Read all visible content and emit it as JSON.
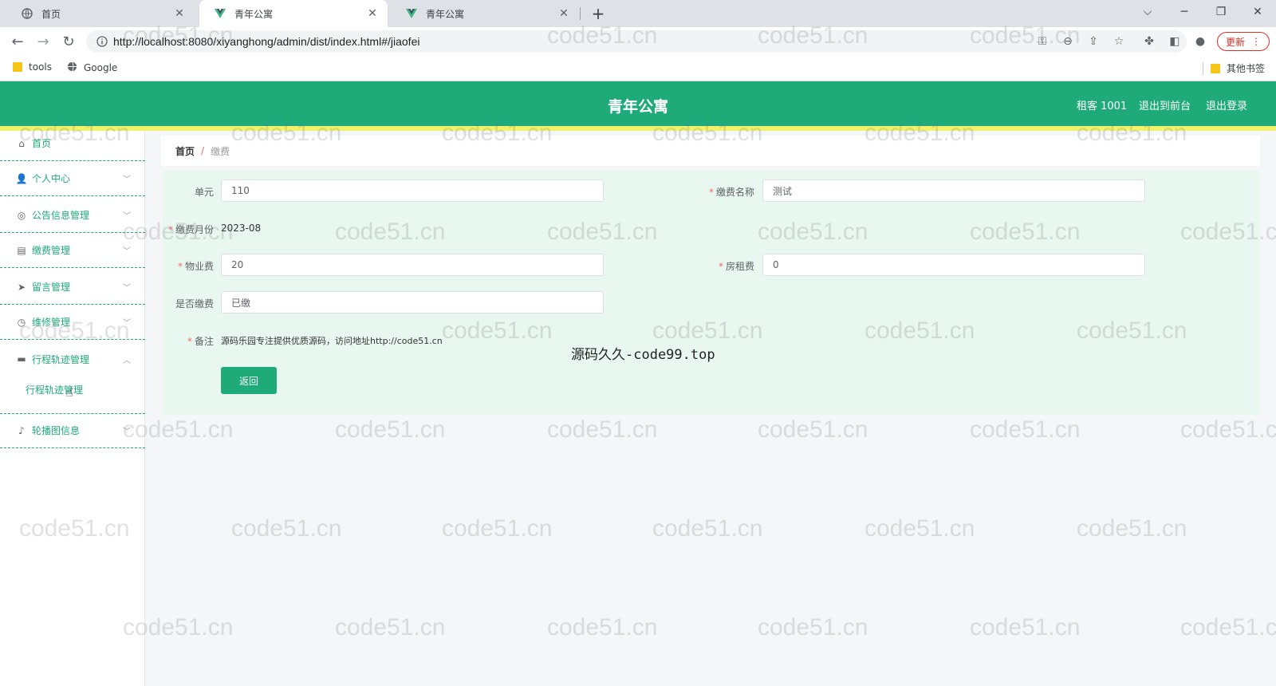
{
  "browser": {
    "tabs": [
      {
        "title": "首页",
        "icon": "globe-icon"
      },
      {
        "title": "青年公寓",
        "icon": "vue-logo-icon"
      },
      {
        "title": "青年公寓",
        "icon": "vue-logo-icon"
      }
    ],
    "url": "http://localhost:8080/xiyanghong/admin/dist/index.html#/jiaofei",
    "update_label": "更新",
    "bookmarks": [
      {
        "label": "tools",
        "icon": "folder-icon"
      },
      {
        "label": "Google",
        "icon": "globe-icon"
      }
    ],
    "other_bookmarks": "其他书签"
  },
  "header": {
    "title": "青年公寓",
    "user": "租客 1001",
    "to_front": "退出到前台",
    "logout": "退出登录"
  },
  "sidebar": {
    "items": [
      {
        "label": "首页",
        "icon": "home-icon"
      },
      {
        "label": "个人中心",
        "icon": "user-icon"
      },
      {
        "label": "公告信息管理",
        "icon": "notice-icon"
      },
      {
        "label": "缴费管理",
        "icon": "payment-icon"
      },
      {
        "label": "留言管理",
        "icon": "send-icon"
      },
      {
        "label": "维修管理",
        "icon": "repair-icon"
      },
      {
        "label": "行程轨迹管理",
        "icon": "route-icon"
      },
      {
        "label": "轮播图信息",
        "icon": "carousel-icon"
      }
    ],
    "submenu": "行程轨迹管理"
  },
  "breadcrumb": {
    "home": "首页",
    "sep": "/",
    "current": "缴费"
  },
  "form": {
    "unit_label": "单元",
    "unit_value": "110",
    "fee_name_label": "缴费名称",
    "fee_name_value": "测试",
    "month_label": "缴费月份",
    "month_value": "2023-08",
    "property_fee_label": "物业费",
    "property_fee_value": "20",
    "rent_label": "房租费",
    "rent_value": "0",
    "paid_label": "是否缴费",
    "paid_value": "已缴",
    "remark_label": "备注",
    "remark_value": "源码乐园专注提供优质源码，访问地址http://code51.cn",
    "back_button": "返回"
  },
  "overlay": "源码久久-code99.top",
  "watermark": "code51.cn"
}
